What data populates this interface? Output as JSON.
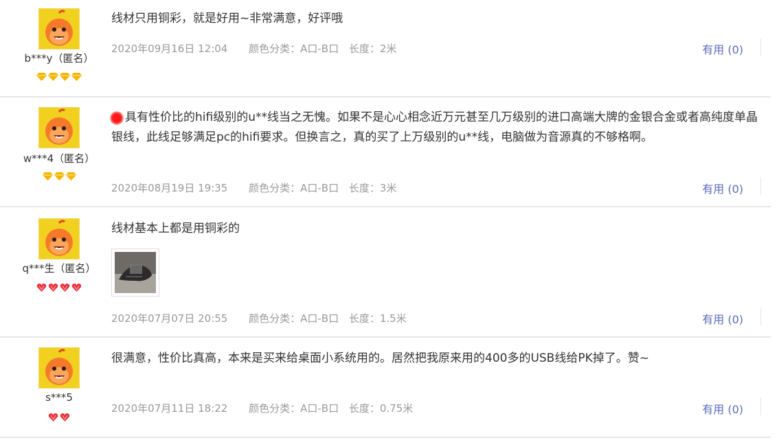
{
  "reviews": [
    {
      "user": "b***y（匿名）",
      "badge_type": "gold",
      "badge_count": 4,
      "content": "线材只用铜彩，就是好用~非常满意，好评哦",
      "date": "2020年09月16日 12:04",
      "color_label": "颜色分类：A口-B口",
      "length_label": "长度：2米",
      "useful": "有用 (0)"
    },
    {
      "user": "w***4（匿名）",
      "badge_type": "gold",
      "badge_count": 3,
      "content": "具有性价比的hifi级别的u**线当之无愧。如果不是心心相念近万元甚至几万级别的进口高端大牌的金银合金或者高纯度单晶银线，此线足够满足pc的hifi要求。但换言之，真的买了上万级别的u**线，电脑做为音源真的不够格啊。",
      "date": "2020年08月19日 19:35",
      "color_label": "颜色分类：A口-B口",
      "length_label": "长度：3米",
      "useful": "有用 (0)"
    },
    {
      "user": "q***生（匿名）",
      "badge_type": "red",
      "badge_count": 4,
      "content": "线材基本上都是用铜彩的",
      "date": "2020年07月07日 20:55",
      "color_label": "颜色分类：A口-B口",
      "length_label": "长度：1.5米",
      "useful": "有用 (0)"
    },
    {
      "user": "s***5",
      "badge_type": "red",
      "badge_count": 2,
      "content": "很满意，性价比真高，本来是买来给桌面小系统用的。居然把我原来用的400多的USB线给PK掉了。赞~",
      "date": "2020年07月11日 18:22",
      "color_label": "颜色分类：A口-B口",
      "length_label": "长度：0.75米",
      "useful": "有用 (0)"
    }
  ],
  "colors": {
    "gold_badge": "#f5b400",
    "red_badge": "#e8303a",
    "useful_link": "#5b6cb8",
    "meta_text": "#999999",
    "avatar_bg": "#f2d020"
  }
}
